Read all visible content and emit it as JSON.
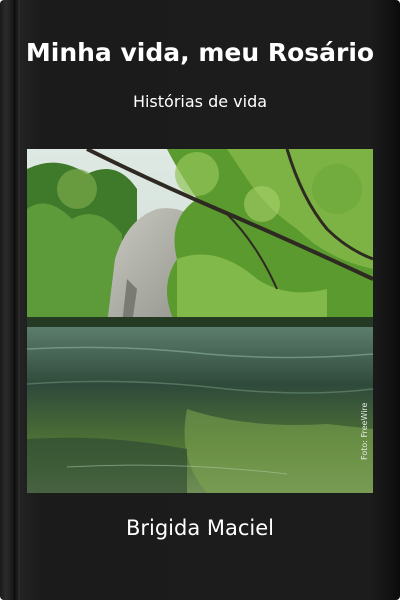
{
  "book": {
    "title": "Minha vida, meu Rosário",
    "subtitle": "Histórias de vida",
    "author": "Brigida Maciel",
    "photo_credit": "Foto: FreeWire",
    "colors": {
      "cover_background": "#1c1c1c",
      "text": "#ffffff",
      "foliage": "#4f8a2a",
      "water": "#2f4a3a"
    }
  }
}
